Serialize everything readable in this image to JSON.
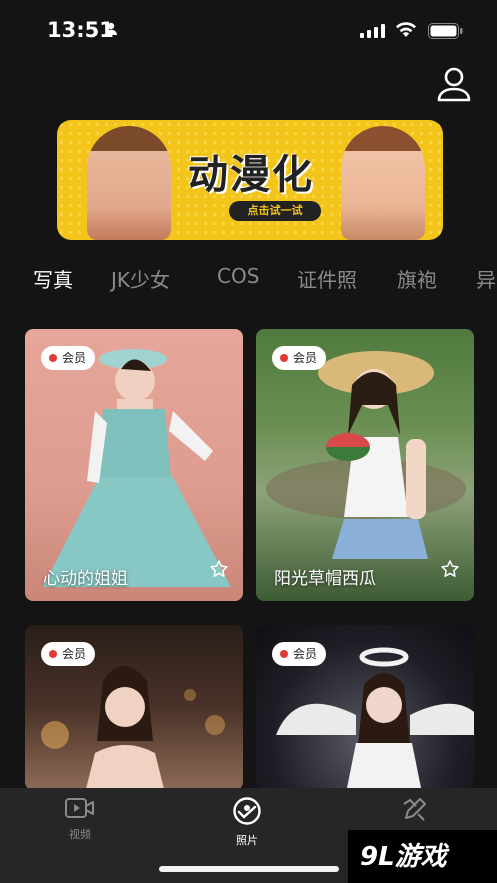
{
  "status_bar": {
    "time": "13:51"
  },
  "banner": {
    "title": "动漫化",
    "cta": "点击试一试"
  },
  "category_tabs": [
    {
      "label": "写真",
      "active": true
    },
    {
      "label": "JK少女",
      "active": false
    },
    {
      "label": "COS",
      "active": false
    },
    {
      "label": "证件照",
      "active": false
    },
    {
      "label": "旗袍",
      "active": false
    },
    {
      "label": "异",
      "active": false
    }
  ],
  "cards": [
    {
      "badge": "会员",
      "title": "心动的姐姐"
    },
    {
      "badge": "会员",
      "title": "阳光草帽西瓜"
    },
    {
      "badge": "会员",
      "title": ""
    },
    {
      "badge": "会员",
      "title": ""
    }
  ],
  "bottom_nav": [
    {
      "label": "视频",
      "icon": "video-icon",
      "active": false
    },
    {
      "label": "照片",
      "icon": "photo-icon",
      "active": true
    },
    {
      "label": "",
      "icon": "edit-icon",
      "active": false
    }
  ],
  "watermark": {
    "text": "9L游戏"
  },
  "colors": {
    "background": "#141414",
    "banner": "#f3c419",
    "badge_dot": "#e53935",
    "tabbar": "#262626"
  }
}
